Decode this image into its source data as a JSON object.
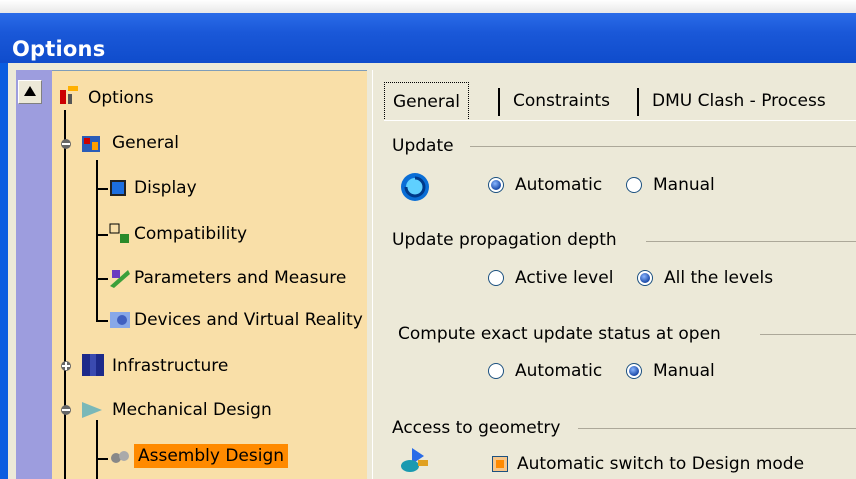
{
  "window": {
    "title": "Options"
  },
  "tree": {
    "root": "Options",
    "items": [
      {
        "label": "General"
      },
      {
        "label": "Display"
      },
      {
        "label": "Compatibility"
      },
      {
        "label": "Parameters and Measure"
      },
      {
        "label": "Devices and Virtual Reality"
      },
      {
        "label": "Infrastructure"
      },
      {
        "label": "Mechanical Design"
      },
      {
        "label": "Assembly Design"
      }
    ]
  },
  "tabs": [
    {
      "label": "General"
    },
    {
      "label": "Constraints"
    },
    {
      "label": "DMU Clash - Process"
    }
  ],
  "sections": {
    "update": {
      "title": "Update",
      "opt1": "Automatic",
      "opt2": "Manual"
    },
    "propagation": {
      "title": "Update propagation depth",
      "opt1": "Active level",
      "opt2": "All the levels"
    },
    "exact": {
      "title": "Compute exact update status at open",
      "opt1": "Automatic",
      "opt2": "Manual"
    },
    "access": {
      "title": "Access to geometry",
      "check": "Automatic switch to Design mode"
    }
  },
  "colors": {
    "selected": "#ff8a00",
    "tree_bg": "#f9dfa8",
    "title_bar": "#1a58d8"
  }
}
